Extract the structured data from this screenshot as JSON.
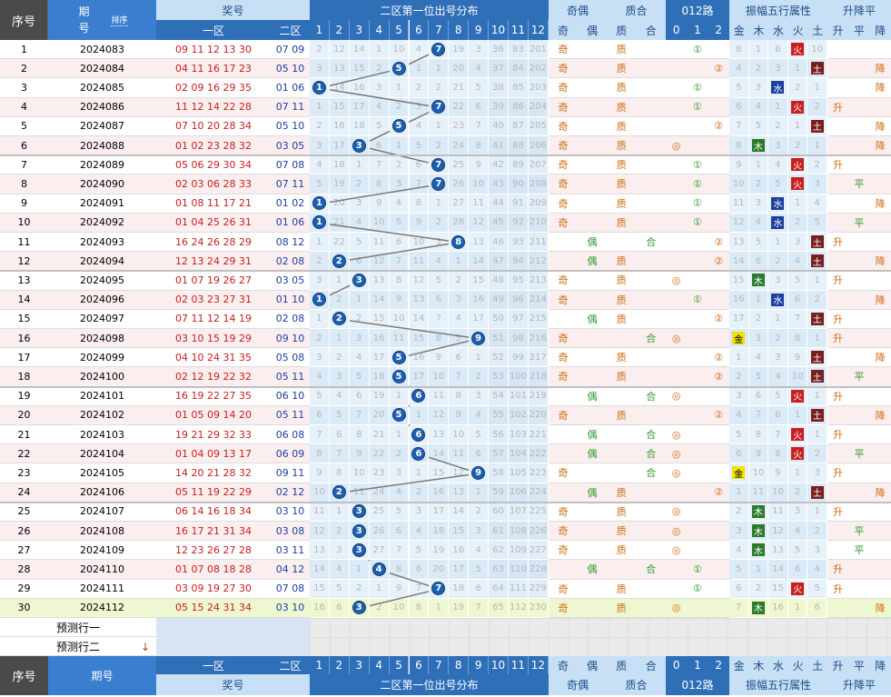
{
  "header": {
    "seq": "序号",
    "period": "期号",
    "sort_label": "排序",
    "prize": "奖号",
    "zone1": "一区",
    "zone2": "二区",
    "dist_title": "二区第一位出号分布",
    "odd_even": "奇偶",
    "odd": "奇",
    "even": "偶",
    "prime_comp": "质合",
    "prime": "质",
    "comp": "合",
    "mod_title": "012路",
    "wuxing_title": "振幅五行属性",
    "wuxing": [
      "金",
      "木",
      "水",
      "火",
      "土"
    ],
    "trend_title": "升降平",
    "up": "升",
    "flat": "平",
    "down": "降",
    "mods": [
      "0",
      "1",
      "2"
    ],
    "cols": [
      "1",
      "2",
      "3",
      "4",
      "5",
      "6",
      "7",
      "8",
      "9",
      "10",
      "11",
      "12"
    ]
  },
  "footer": {
    "predict1": "预测行一",
    "predict2": "预测行二",
    "arrow": "↓"
  },
  "rows": [
    {
      "seq": "1",
      "period": "2024083",
      "z1": "09 11 12 13 30",
      "z2": "07 09",
      "pos": 7,
      "grid": [
        "2",
        "12",
        "14",
        "1",
        "10",
        "4",
        "",
        "19",
        "3",
        "36",
        "83",
        "201"
      ],
      "oe": "奇",
      "pc": "质",
      "mod": "1",
      "amp": [
        "8",
        "1",
        "6",
        "",
        "10"
      ],
      "wx": "火",
      "wxi": 3,
      "tr": ""
    },
    {
      "seq": "2",
      "period": "2024084",
      "z1": "04 11 16 17 23",
      "z2": "05 10",
      "pos": 5,
      "grid": [
        "3",
        "13",
        "15",
        "2",
        "",
        "1",
        "1",
        "20",
        "4",
        "37",
        "84",
        "202"
      ],
      "oe": "奇",
      "pc": "质",
      "mod": "2",
      "amp": [
        "4",
        "2",
        "3",
        "1",
        ""
      ],
      "wx": "土",
      "wxi": 4,
      "tr": "降"
    },
    {
      "seq": "3",
      "period": "2024085",
      "z1": "02 09 16 29 35",
      "z2": "01 06",
      "pos": 1,
      "grid": [
        "",
        "14",
        "16",
        "3",
        "1",
        "2",
        "2",
        "21",
        "5",
        "38",
        "85",
        "203"
      ],
      "oe": "奇",
      "pc": "质",
      "mod": "1",
      "amp": [
        "5",
        "3",
        "",
        "2",
        "1"
      ],
      "wx": "水",
      "wxi": 2,
      "tr": "降"
    },
    {
      "seq": "4",
      "period": "2024086",
      "z1": "11 12 14 22 28",
      "z2": "07 11",
      "pos": 7,
      "grid": [
        "1",
        "15",
        "17",
        "4",
        "2",
        "3",
        "",
        "22",
        "6",
        "39",
        "86",
        "204"
      ],
      "oe": "奇",
      "pc": "质",
      "mod": "1",
      "amp": [
        "6",
        "4",
        "1",
        "",
        "2"
      ],
      "wx": "火",
      "wxi": 3,
      "tr": "升"
    },
    {
      "seq": "5",
      "period": "2024087",
      "z1": "07 10 20 28 34",
      "z2": "05 10",
      "pos": 5,
      "grid": [
        "2",
        "16",
        "18",
        "5",
        "",
        "4",
        "1",
        "23",
        "7",
        "40",
        "87",
        "205"
      ],
      "oe": "奇",
      "pc": "质",
      "mod": "2",
      "amp": [
        "7",
        "5",
        "2",
        "1",
        ""
      ],
      "wx": "土",
      "wxi": 4,
      "tr": "降"
    },
    {
      "seq": "6",
      "period": "2024088",
      "z1": "01 02 23 28 32",
      "z2": "03 05",
      "pos": 3,
      "grid": [
        "3",
        "17",
        "",
        "6",
        "1",
        "5",
        "2",
        "24",
        "8",
        "41",
        "88",
        "206"
      ],
      "oe": "奇",
      "pc": "质",
      "mod": "0",
      "amp": [
        "8",
        "",
        "3",
        "2",
        "1"
      ],
      "wx": "木",
      "wxi": 1,
      "tr": "降"
    },
    {
      "seq": "7",
      "period": "2024089",
      "z1": "05 06 29 30 34",
      "z2": "07 08",
      "pos": 7,
      "grid": [
        "4",
        "18",
        "1",
        "7",
        "2",
        "6",
        "",
        "25",
        "9",
        "42",
        "89",
        "207"
      ],
      "oe": "奇",
      "pc": "质",
      "mod": "1",
      "amp": [
        "9",
        "1",
        "4",
        "",
        "2"
      ],
      "wx": "火",
      "wxi": 3,
      "tr": "升"
    },
    {
      "seq": "8",
      "period": "2024090",
      "z1": "02 03 06 28 33",
      "z2": "07 11",
      "pos": 7,
      "grid": [
        "5",
        "19",
        "2",
        "8",
        "3",
        "7",
        "",
        "26",
        "10",
        "43",
        "90",
        "208"
      ],
      "oe": "奇",
      "pc": "质",
      "mod": "1",
      "amp": [
        "10",
        "2",
        "5",
        "",
        "3"
      ],
      "wx": "火",
      "wxi": 3,
      "tr": "平"
    },
    {
      "seq": "9",
      "period": "2024091",
      "z1": "01 08 11 17 21",
      "z2": "01 02",
      "pos": 1,
      "grid": [
        "",
        "20",
        "3",
        "9",
        "4",
        "8",
        "1",
        "27",
        "11",
        "44",
        "91",
        "209"
      ],
      "oe": "奇",
      "pc": "质",
      "mod": "1",
      "amp": [
        "11",
        "3",
        "",
        "1",
        "4"
      ],
      "wx": "水",
      "wxi": 2,
      "tr": "降"
    },
    {
      "seq": "10",
      "period": "2024092",
      "z1": "01 04 25 26 31",
      "z2": "01 06",
      "pos": 1,
      "grid": [
        "",
        "21",
        "4",
        "10",
        "5",
        "9",
        "2",
        "28",
        "12",
        "45",
        "92",
        "210"
      ],
      "oe": "奇",
      "pc": "质",
      "mod": "1",
      "amp": [
        "12",
        "4",
        "",
        "2",
        "5"
      ],
      "wx": "水",
      "wxi": 2,
      "tr": "平"
    },
    {
      "seq": "11",
      "period": "2024093",
      "z1": "16 24 26 28 29",
      "z2": "08 12",
      "pos": 8,
      "grid": [
        "1",
        "22",
        "5",
        "11",
        "6",
        "10",
        "3",
        "",
        "13",
        "46",
        "93",
        "211"
      ],
      "oe": "偶",
      "pc": "合",
      "mod": "2",
      "amp": [
        "13",
        "5",
        "1",
        "3",
        ""
      ],
      "wx": "土",
      "wxi": 4,
      "tr": "升"
    },
    {
      "seq": "12",
      "period": "2024094",
      "z1": "12 13 24 29 31",
      "z2": "02 08",
      "pos": 2,
      "grid": [
        "2",
        "",
        "6",
        "12",
        "7",
        "11",
        "4",
        "1",
        "14",
        "47",
        "94",
        "212"
      ],
      "oe": "偶",
      "pc": "质",
      "mod": "2",
      "amp": [
        "14",
        "6",
        "2",
        "4",
        ""
      ],
      "wx": "土",
      "wxi": 4,
      "tr": "降"
    },
    {
      "seq": "13",
      "period": "2024095",
      "z1": "01 07 19 26 27",
      "z2": "03 05",
      "pos": 3,
      "grid": [
        "3",
        "1",
        "",
        "13",
        "8",
        "12",
        "5",
        "2",
        "15",
        "48",
        "95",
        "213"
      ],
      "oe": "奇",
      "pc": "质",
      "mod": "0",
      "amp": [
        "15",
        "",
        "3",
        "5",
        "1"
      ],
      "wx": "木",
      "wxi": 1,
      "tr": "升"
    },
    {
      "seq": "14",
      "period": "2024096",
      "z1": "02 03 23 27 31",
      "z2": "01 10",
      "pos": 1,
      "grid": [
        "",
        "2",
        "1",
        "14",
        "9",
        "13",
        "6",
        "3",
        "16",
        "49",
        "96",
        "214"
      ],
      "oe": "奇",
      "pc": "质",
      "mod": "1",
      "amp": [
        "16",
        "1",
        "",
        "6",
        "2"
      ],
      "wx": "水",
      "wxi": 2,
      "tr": "降"
    },
    {
      "seq": "15",
      "period": "2024097",
      "z1": "07 11 12 14 19",
      "z2": "02 08",
      "pos": 2,
      "grid": [
        "1",
        "",
        "2",
        "15",
        "10",
        "14",
        "7",
        "4",
        "17",
        "50",
        "97",
        "215"
      ],
      "oe": "偶",
      "pc": "质",
      "mod": "2",
      "amp": [
        "17",
        "2",
        "1",
        "7",
        ""
      ],
      "wx": "土",
      "wxi": 4,
      "tr": "升"
    },
    {
      "seq": "16",
      "period": "2024098",
      "z1": "03 10 15 19 29",
      "z2": "09 10",
      "pos": 9,
      "grid": [
        "2",
        "1",
        "3",
        "16",
        "11",
        "15",
        "8",
        "5",
        "",
        "51",
        "98",
        "216"
      ],
      "oe": "奇",
      "pc": "合",
      "mod": "0",
      "amp": [
        "",
        "3",
        "2",
        "8",
        "1"
      ],
      "wx": "金",
      "wxi": 0,
      "tr": "升"
    },
    {
      "seq": "17",
      "period": "2024099",
      "z1": "04 10 24 31 35",
      "z2": "05 08",
      "pos": 5,
      "grid": [
        "3",
        "2",
        "4",
        "17",
        "",
        "16",
        "9",
        "6",
        "1",
        "52",
        "99",
        "217"
      ],
      "oe": "奇",
      "pc": "质",
      "mod": "2",
      "amp": [
        "1",
        "4",
        "3",
        "9",
        ""
      ],
      "wx": "土",
      "wxi": 4,
      "tr": "降"
    },
    {
      "seq": "18",
      "period": "2024100",
      "z1": "02 12 19 22 32",
      "z2": "05 11",
      "pos": 5,
      "grid": [
        "4",
        "3",
        "5",
        "18",
        "",
        "17",
        "10",
        "7",
        "2",
        "53",
        "100",
        "218"
      ],
      "oe": "奇",
      "pc": "质",
      "mod": "2",
      "amp": [
        "2",
        "5",
        "4",
        "10",
        ""
      ],
      "wx": "土",
      "wxi": 4,
      "tr": "平"
    },
    {
      "seq": "19",
      "period": "2024101",
      "z1": "16 19 22 27 35",
      "z2": "06 10",
      "pos": 6,
      "grid": [
        "5",
        "4",
        "6",
        "19",
        "1",
        "",
        "11",
        "8",
        "3",
        "54",
        "101",
        "219"
      ],
      "oe": "偶",
      "pc": "合",
      "mod": "0",
      "amp": [
        "3",
        "6",
        "5",
        "",
        "1"
      ],
      "wx": "火",
      "wxi": 3,
      "tr": "升"
    },
    {
      "seq": "20",
      "period": "2024102",
      "z1": "01 05 09 14 20",
      "z2": "05 11",
      "pos": 5,
      "grid": [
        "6",
        "5",
        "7",
        "20",
        "",
        "1",
        "12",
        "9",
        "4",
        "55",
        "102",
        "220"
      ],
      "oe": "奇",
      "pc": "质",
      "mod": "2",
      "amp": [
        "4",
        "7",
        "6",
        "1",
        ""
      ],
      "wx": "土",
      "wxi": 4,
      "tr": "降"
    },
    {
      "seq": "21",
      "period": "2024103",
      "z1": "19 21 29 32 33",
      "z2": "06 08",
      "pos": 6,
      "grid": [
        "7",
        "6",
        "8",
        "21",
        "1",
        "",
        "13",
        "10",
        "5",
        "56",
        "103",
        "221"
      ],
      "oe": "偶",
      "pc": "合",
      "mod": "0",
      "amp": [
        "5",
        "8",
        "7",
        "",
        "1"
      ],
      "wx": "火",
      "wxi": 3,
      "tr": "升"
    },
    {
      "seq": "22",
      "period": "2024104",
      "z1": "01 04 09 13 17",
      "z2": "06 09",
      "pos": 6,
      "grid": [
        "8",
        "7",
        "9",
        "22",
        "2",
        "",
        "14",
        "11",
        "6",
        "57",
        "104",
        "222"
      ],
      "oe": "偶",
      "pc": "合",
      "mod": "0",
      "amp": [
        "6",
        "9",
        "8",
        "",
        "2"
      ],
      "wx": "火",
      "wxi": 3,
      "tr": "平"
    },
    {
      "seq": "23",
      "period": "2024105",
      "z1": "14 20 21 28 32",
      "z2": "09 11",
      "pos": 9,
      "grid": [
        "9",
        "8",
        "10",
        "23",
        "3",
        "1",
        "15",
        "12",
        "",
        "58",
        "105",
        "223"
      ],
      "oe": "奇",
      "pc": "合",
      "mod": "0",
      "amp": [
        "",
        "10",
        "9",
        "1",
        "3"
      ],
      "wx": "金",
      "wxi": 0,
      "tr": "升"
    },
    {
      "seq": "24",
      "period": "2024106",
      "z1": "05 11 19 22 29",
      "z2": "02 12",
      "pos": 2,
      "grid": [
        "10",
        "",
        "11",
        "24",
        "4",
        "2",
        "16",
        "13",
        "1",
        "59",
        "106",
        "224"
      ],
      "oe": "偶",
      "pc": "质",
      "mod": "2",
      "amp": [
        "1",
        "11",
        "10",
        "2",
        ""
      ],
      "wx": "土",
      "wxi": 4,
      "tr": "降"
    },
    {
      "seq": "25",
      "period": "2024107",
      "z1": "06 14 16 18 34",
      "z2": "03 10",
      "pos": 3,
      "grid": [
        "11",
        "1",
        "",
        "25",
        "5",
        "3",
        "17",
        "14",
        "2",
        "60",
        "107",
        "225"
      ],
      "oe": "奇",
      "pc": "质",
      "mod": "0",
      "amp": [
        "2",
        "",
        "11",
        "3",
        "1"
      ],
      "wx": "木",
      "wxi": 1,
      "tr": "升"
    },
    {
      "seq": "26",
      "period": "2024108",
      "z1": "16 17 21 31 34",
      "z2": "03 08",
      "pos": 3,
      "grid": [
        "12",
        "2",
        "",
        "26",
        "6",
        "4",
        "18",
        "15",
        "3",
        "61",
        "108",
        "226"
      ],
      "oe": "奇",
      "pc": "质",
      "mod": "0",
      "amp": [
        "3",
        "",
        "12",
        "4",
        "2"
      ],
      "wx": "木",
      "wxi": 1,
      "tr": "平"
    },
    {
      "seq": "27",
      "period": "2024109",
      "z1": "12 23 26 27 28",
      "z2": "03 11",
      "pos": 3,
      "grid": [
        "13",
        "3",
        "",
        "27",
        "7",
        "5",
        "19",
        "16",
        "4",
        "62",
        "109",
        "227"
      ],
      "oe": "奇",
      "pc": "质",
      "mod": "0",
      "amp": [
        "4",
        "",
        "13",
        "5",
        "3"
      ],
      "wx": "木",
      "wxi": 1,
      "tr": "平"
    },
    {
      "seq": "28",
      "period": "2024110",
      "z1": "01 07 08 18 28",
      "z2": "04 12",
      "pos": 4,
      "grid": [
        "14",
        "4",
        "1",
        "",
        "8",
        "6",
        "20",
        "17",
        "5",
        "63",
        "110",
        "228"
      ],
      "oe": "偶",
      "pc": "合",
      "mod": "1",
      "amp": [
        "5",
        "1",
        "14",
        "6",
        "4"
      ],
      "wx": "木",
      "wxi": -1,
      "tr": "升"
    },
    {
      "seq": "29",
      "period": "2024111",
      "z1": "03 09 19 27 30",
      "z2": "07 08",
      "pos": 7,
      "grid": [
        "15",
        "5",
        "2",
        "1",
        "9",
        "7",
        "",
        "18",
        "6",
        "64",
        "111",
        "229"
      ],
      "oe": "奇",
      "pc": "质",
      "mod": "1",
      "amp": [
        "6",
        "2",
        "15",
        "",
        "5"
      ],
      "wx": "火",
      "wxi": 3,
      "tr": "升"
    },
    {
      "seq": "30",
      "period": "2024112",
      "z1": "05 15 24 31 34",
      "z2": "03 10",
      "pos": 3,
      "grid": [
        "16",
        "6",
        "",
        "2",
        "10",
        "8",
        "1",
        "19",
        "7",
        "65",
        "112",
        "230"
      ],
      "oe": "奇",
      "pc": "质",
      "mod": "0",
      "amp": [
        "7",
        "",
        "16",
        "1",
        "6"
      ],
      "wx": "木",
      "wxi": 1,
      "tr": "降"
    }
  ],
  "colors": {
    "accent": "#3a7ed0",
    "ball": "#1e5fb0",
    "fire": "#c81e1e",
    "earth": "#7a1e1e",
    "water": "#1e3fa0",
    "wood": "#2a7a2a",
    "metal": "#f2e200"
  }
}
